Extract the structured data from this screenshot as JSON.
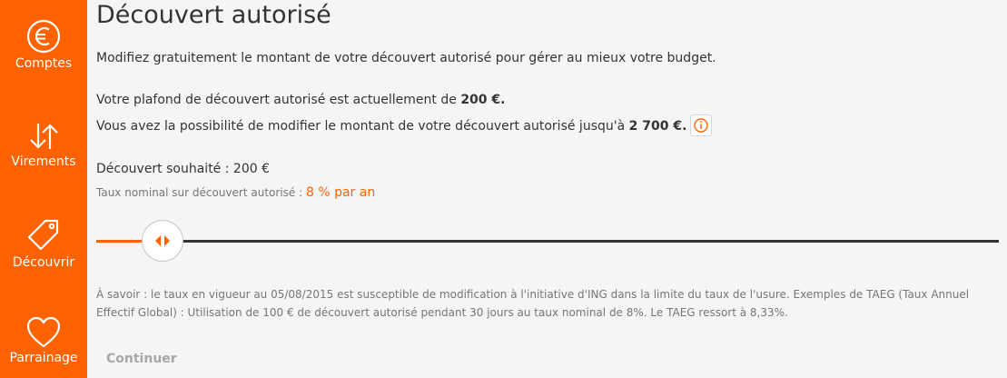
{
  "sidebar": {
    "items": [
      {
        "label": "Comptes",
        "icon": "euro-icon"
      },
      {
        "label": "Virements",
        "icon": "transfer-arrows-icon"
      },
      {
        "label": "Découvrir",
        "icon": "tag-icon"
      },
      {
        "label": "Parrainage",
        "icon": "heart-icon"
      }
    ]
  },
  "main": {
    "title": "Découvert autorisé",
    "intro": "Modifiez gratuitement le montant de votre découvert autorisé pour gérer au mieux votre budget.",
    "current_prefix": "Votre plafond de découvert autorisé est actuellement de ",
    "current_amount": "200 €.",
    "max_prefix": "Vous avez la possibilité de modifier le montant de votre découvert autorisé jusqu'à ",
    "max_amount": "2 700 €.",
    "desired_label": "Découvert souhaité : 200 €",
    "rate_label": "Taux nominal sur découvert autorisé : ",
    "rate_value": "8 % par an",
    "note": "À savoir : le taux en vigueur au 05/08/2015 est susceptible de modification à l'initiative d'ING dans la limite du taux de l'usure. Exemples de TAEG (Taux Annuel Effectif Global) : Utilisation de 100 € de découvert autorisé pendant 30 jours au taux nominal de 8%. Le TAEG ressort à 8,33%.",
    "continue_label": "Continuer"
  },
  "slider": {
    "value": 200,
    "min": 0,
    "max": 2700
  },
  "colors": {
    "accent": "#ff6200",
    "text": "#333333",
    "muted": "#767676",
    "background": "#f5f5f5"
  }
}
